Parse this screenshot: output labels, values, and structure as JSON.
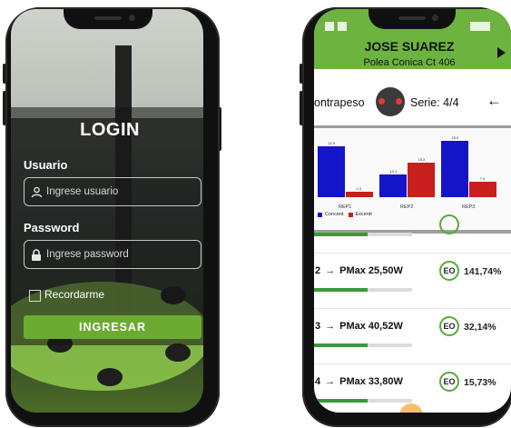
{
  "login_screen": {
    "title": "LOGIN",
    "username_label": "Usuario",
    "username_placeholder": "Ingrese usuario",
    "password_label": "Password",
    "password_placeholder": "Ingrese password",
    "remember_label": "Recordarme",
    "submit_label": "INGRESAR"
  },
  "session_screen": {
    "user_name": "JOSE SUAREZ",
    "device_name": "Polea Conica Ct 406",
    "counterweight_label": "ontrapeso",
    "series_label": "Serie:",
    "series_value": "4/4",
    "back_icon": "arrow-left-icon",
    "play_icon": "play-icon",
    "colors": {
      "header": "#6cb33f",
      "concentric": "#1414c8",
      "eccentric": "#c81e1e",
      "accent": "#58a935"
    },
    "chart_data": {
      "type": "bar",
      "categories": [
        "REP1",
        "REP2",
        "REP3"
      ],
      "series": [
        {
          "name": "Concent",
          "values": [
            22.5,
            10.1,
            25.0
          ]
        },
        {
          "name": "Excentr",
          "values": [
            2.3,
            15.3,
            7.0
          ]
        }
      ],
      "value_labels": {
        "Concent": [
          "22.5",
          "10.1",
          "25.0"
        ],
        "Excentr": [
          "2.3",
          "15.3",
          "7.0"
        ]
      }
    },
    "reps": [
      {
        "index": "",
        "label": "",
        "value": "",
        "eo_text": "",
        "percent": "",
        "progress": 0.55
      },
      {
        "index": "2",
        "label": "PMax",
        "value": "25,50W",
        "eo_text": "EO",
        "percent": "141,74%",
        "progress": 0.55
      },
      {
        "index": "3",
        "label": "PMax",
        "value": "40,52W",
        "eo_text": "EO",
        "percent": "32,14%",
        "progress": 0.55
      },
      {
        "index": "4",
        "label": "PMax",
        "value": "33,80W",
        "eo_text": "EO",
        "percent": "15,73%",
        "progress": 0.55
      }
    ],
    "rep_arrow": "→"
  }
}
